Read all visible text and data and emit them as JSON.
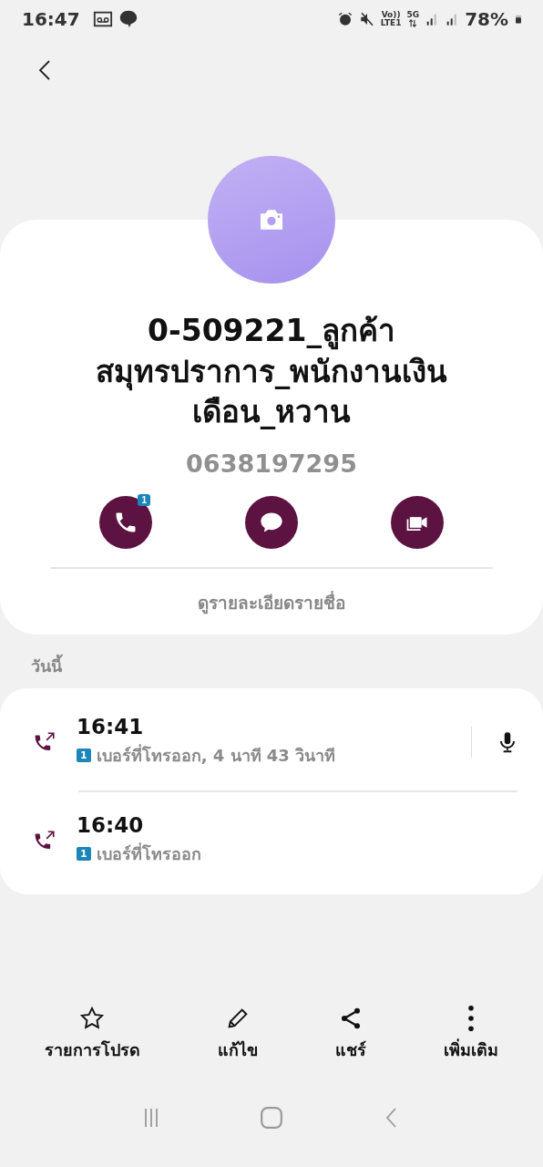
{
  "status_bar": {
    "time": "16:47",
    "volte": "Vo))",
    "lte": "LTE1",
    "network": "5G",
    "battery": "78%"
  },
  "contact": {
    "name": "0-509221_ลูกค้าสมุทรปราการ_พนักงานเงินเดือน_หวาน",
    "phone": "0638197295",
    "details_link": "ดูรายละเอียดรายชื่อ"
  },
  "actions": [
    {
      "kind": "call",
      "badge": "1"
    },
    {
      "kind": "message"
    },
    {
      "kind": "video"
    }
  ],
  "history": {
    "heading": "วันนี้",
    "calls": [
      {
        "time": "16:41",
        "sim": "1",
        "description": "เบอร์ที่โทรออก, 4 นาที 43 วินาที",
        "recording": true
      },
      {
        "time": "16:40",
        "sim": "1",
        "description": "เบอร์ที่โทรออก",
        "recording": false
      }
    ]
  },
  "bottom_actions": [
    {
      "kind": "favorite",
      "label": "รายการโปรด"
    },
    {
      "kind": "edit",
      "label": "แก้ไข"
    },
    {
      "kind": "share",
      "label": "แชร์"
    },
    {
      "kind": "more",
      "label": "เพิ่มเติม"
    }
  ]
}
